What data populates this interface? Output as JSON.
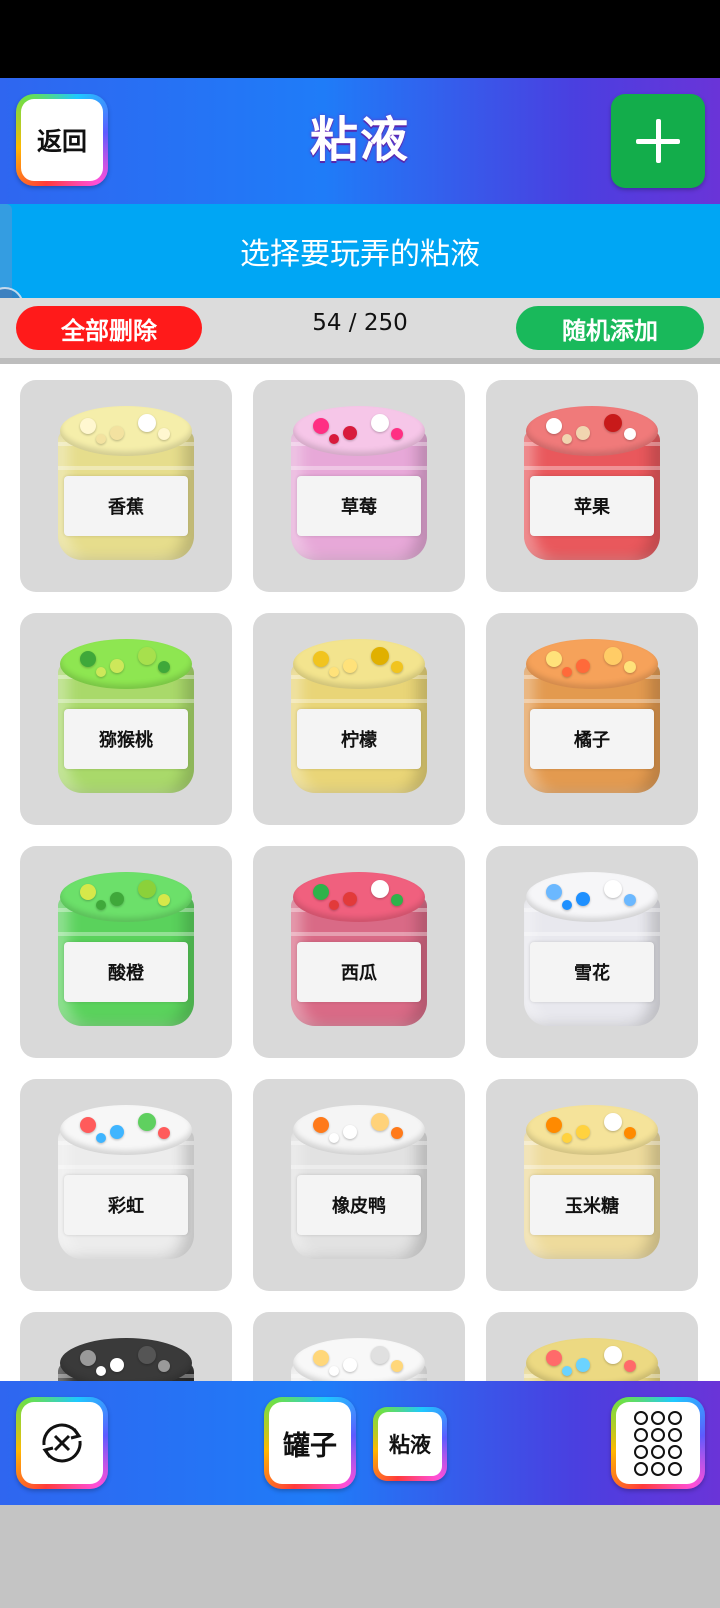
{
  "header": {
    "back_label": "返回",
    "title": "粘液"
  },
  "subtitle": "选择要玩弄的粘液",
  "controls": {
    "delete_all_label": "全部删除",
    "counter": "54 / 250",
    "random_add_label": "随机添加"
  },
  "slimes": [
    {
      "name": "香蕉",
      "color": "#e6dd8c",
      "lid": "#f5eeaa"
    },
    {
      "name": "草莓",
      "color": "#e7a8d8",
      "lid": "#f6c6e8"
    },
    {
      "name": "苹果",
      "color": "#e9585c",
      "lid": "#f07a7a"
    },
    {
      "name": "猕猴桃",
      "color": "#a9d96a",
      "lid": "#8ee651"
    },
    {
      "name": "柠檬",
      "color": "#e9d577",
      "lid": "#f3e48e"
    },
    {
      "name": "橘子",
      "color": "#e39a4f",
      "lid": "#f6a25a"
    },
    {
      "name": "酸橙",
      "color": "#5ad25c",
      "lid": "#6ce06a"
    },
    {
      "name": "西瓜",
      "color": "#d96a86",
      "lid": "#f0607e"
    },
    {
      "name": "雪花",
      "color": "#e8e8ee",
      "lid": "#f6f6f8"
    },
    {
      "name": "彩虹",
      "color": "#ececec",
      "lid": "#f7f7f7"
    },
    {
      "name": "橡皮鸭",
      "color": "#e2e2e2",
      "lid": "#f5f5f5"
    },
    {
      "name": "玉米糖",
      "color": "#eedb9c",
      "lid": "#f5e39a"
    },
    {
      "name": "",
      "color": "#2c2c2c",
      "lid": "#3a3a3a"
    },
    {
      "name": "",
      "color": "#eeeeee",
      "lid": "#f8f8f8"
    },
    {
      "name": "",
      "color": "#e9d783",
      "lid": "#ecd982"
    }
  ],
  "bottom_nav": {
    "reset_icon": "refresh-x-icon",
    "jars_label": "罐子",
    "slime_label": "粘液",
    "menu_icon": "grid-dots-icon"
  }
}
